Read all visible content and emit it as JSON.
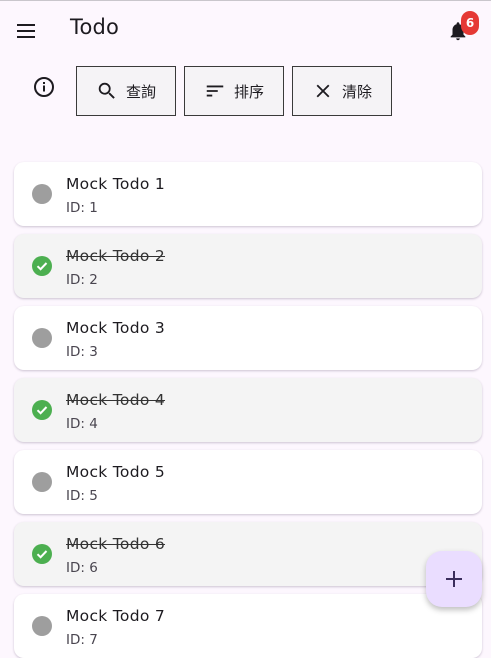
{
  "appbar": {
    "title": "Todo",
    "menu_icon": "menu-icon",
    "notifications": {
      "icon": "bell-icon",
      "badge_count": "6",
      "badge_color": "#e53935"
    }
  },
  "toolbar": {
    "info_icon": "info-icon",
    "search": {
      "label": "查詢",
      "icon": "search-icon"
    },
    "sort": {
      "label": "排序",
      "icon": "sort-icon"
    },
    "clear": {
      "label": "清除",
      "icon": "close-icon"
    }
  },
  "todos": [
    {
      "title": "Mock Todo 1",
      "id_text": "ID: 1",
      "completed": false
    },
    {
      "title": "Mock Todo 2",
      "id_text": "ID: 2",
      "completed": true
    },
    {
      "title": "Mock Todo 3",
      "id_text": "ID: 3",
      "completed": false
    },
    {
      "title": "Mock Todo 4",
      "id_text": "ID: 4",
      "completed": true
    },
    {
      "title": "Mock Todo 5",
      "id_text": "ID: 5",
      "completed": false
    },
    {
      "title": "Mock Todo 6",
      "id_text": "ID: 6",
      "completed": true
    },
    {
      "title": "Mock Todo 7",
      "id_text": "ID: 7",
      "completed": false
    }
  ],
  "fab": {
    "icon": "add-icon",
    "color": "#eaddff"
  },
  "colors": {
    "background": "#fdf7fe",
    "pending": "#9e9e9e",
    "complete": "#4caf50"
  }
}
